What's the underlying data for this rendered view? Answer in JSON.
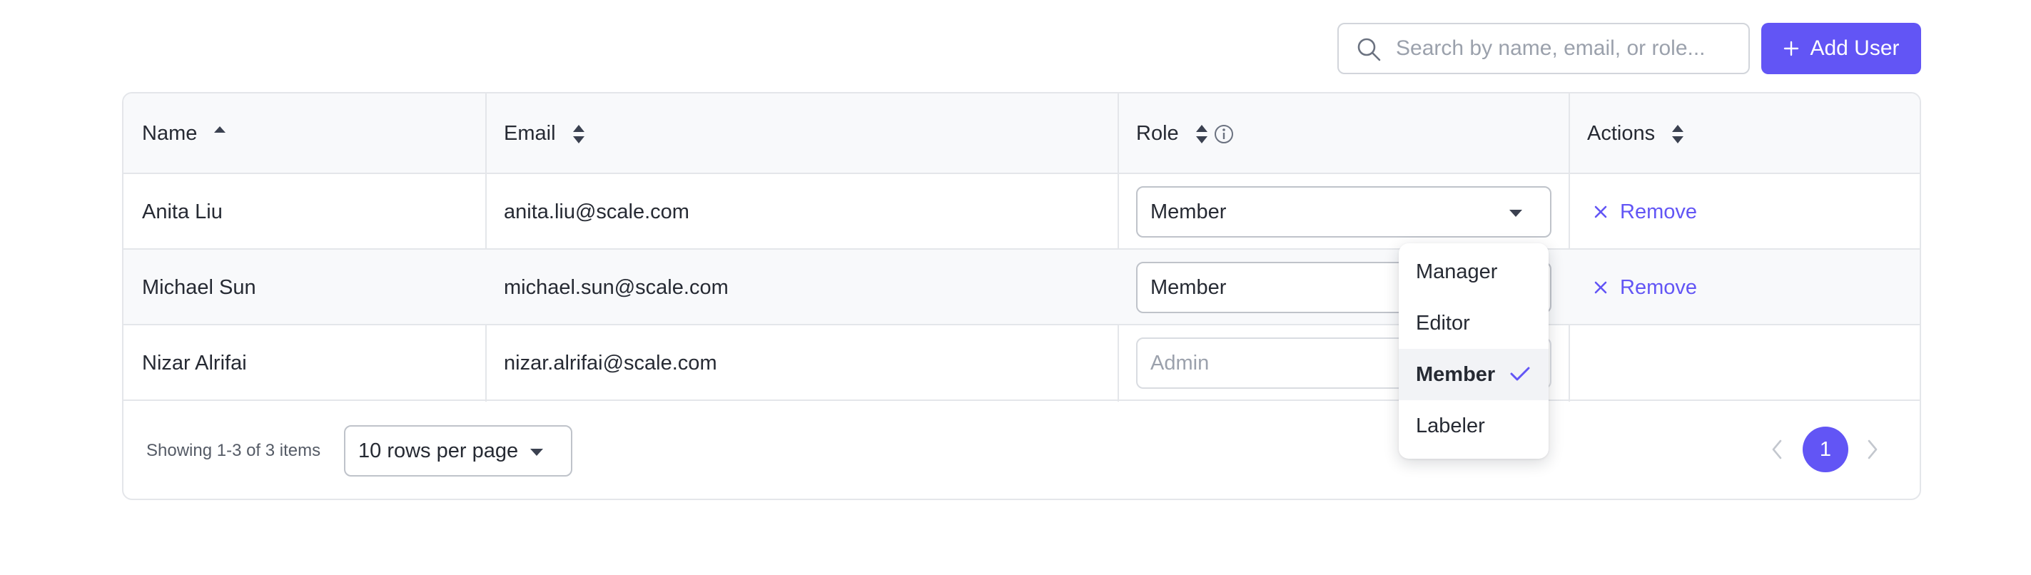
{
  "toolbar": {
    "search_placeholder": "Search by name, email, or role...",
    "add_user_label": "Add User"
  },
  "table": {
    "columns": [
      {
        "label": "Name",
        "sort": "asc"
      },
      {
        "label": "Email",
        "sort": "none"
      },
      {
        "label": "Role",
        "sort": "none",
        "info": true
      },
      {
        "label": "Actions",
        "sort": "none"
      }
    ],
    "rows": [
      {
        "name": "Anita Liu",
        "email": "anita.liu@scale.com",
        "role": "Member",
        "action": "Remove"
      },
      {
        "name": "Michael Sun",
        "email": "michael.sun@scale.com",
        "role": "Member",
        "action": "Remove"
      },
      {
        "name": "Nizar Alrifai",
        "email": "nizar.alrifai@scale.com",
        "role": "Admin",
        "action": ""
      }
    ]
  },
  "role_menu": {
    "options": [
      "Manager",
      "Editor",
      "Member",
      "Labeler"
    ],
    "selected": "Member"
  },
  "footer": {
    "showing_text": "Showing 1-3 of 3 items",
    "page_size_label": "10 rows per page",
    "current_page": "1"
  },
  "colors": {
    "accent": "#6255f5",
    "border": "#e4e6ea",
    "header_bg": "#f8f9fb"
  }
}
